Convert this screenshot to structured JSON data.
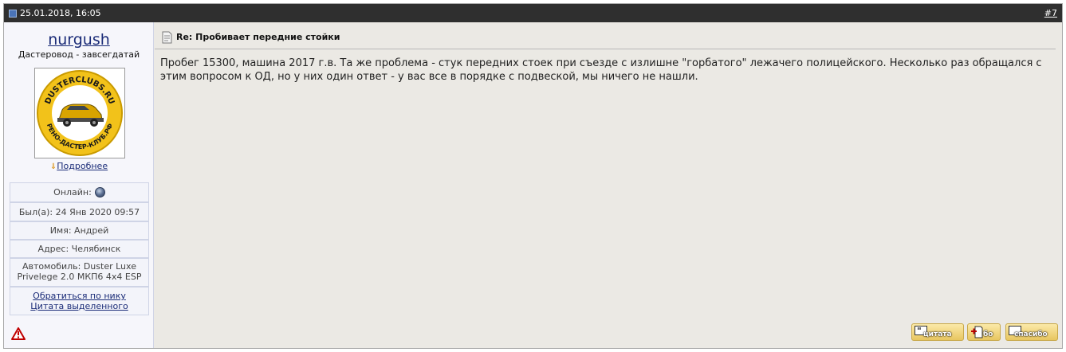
{
  "post": {
    "date": "25.01.2018, 16:05",
    "number": "#7",
    "title": "Re: Пробивает передние стойки",
    "body": "Пробег 15300, машина 2017 г.в. Та же проблема - стук передних стоек при съезде с излишне \"горбатого\" лежачего полицейского. Несколько раз обращался с этим вопросом к ОД, но у них один ответ - у вас все в порядке с подвеской, мы ничего не нашли."
  },
  "user": {
    "name": "nurgush",
    "title": "Дастеровод - завсегдатай",
    "avatar_top_text": "DUSTERCLUBS.RU",
    "avatar_bottom_text": "РЕНО-ДАСТЕР-КЛУБ.РФ",
    "more_link": "Подробнее",
    "online_label": "Онлайн:",
    "last_seen": "Был(а): 24 Янв 2020 09:57",
    "name_field": "Имя: Андрей",
    "address": "Адрес: Челябинск",
    "car": "Автомобиль: Duster Luxe Privelege 2.0 МКП6 4x4 ESP",
    "contact_nick": "Обратиться по нику",
    "quote_selected": "Цитата выделенного"
  },
  "buttons": {
    "quote": "цитата",
    "bo": "бо",
    "thanks": "спасибо"
  },
  "colors": {
    "header_bg": "#2f2f2f",
    "content_bg": "#ebe9e4",
    "user_panel_bg": "#f6f6fb",
    "link": "#1b2c78",
    "warning": "#c00000"
  },
  "icons": {
    "post_icon": "post-status-icon",
    "doc_icon": "document-icon",
    "online_icon": "online-status-icon",
    "warn_icon": "report-warning-icon",
    "more_icon": "double-chevron-down-icon"
  }
}
